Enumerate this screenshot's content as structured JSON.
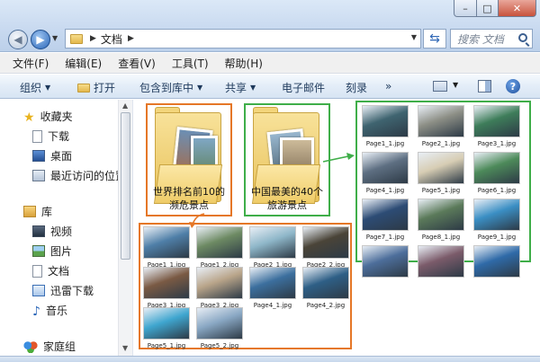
{
  "window": {
    "min_label": "–",
    "max_label": "□",
    "close_label": "✕"
  },
  "address": {
    "path": "文档",
    "search_placeholder": "搜索 文档"
  },
  "menu": [
    "文件(F)",
    "编辑(E)",
    "查看(V)",
    "工具(T)",
    "帮助(H)"
  ],
  "commands": {
    "organize": "组织",
    "open": "打开",
    "include": "包含到库中",
    "share": "共享",
    "email": "电子邮件",
    "burn": "刻录",
    "more": "»",
    "help": "?"
  },
  "nav": {
    "favorites": "收藏夹",
    "downloads": "下载",
    "desktop": "桌面",
    "recent": "最近访问的位置",
    "libraries": "库",
    "videos": "视频",
    "pictures": "图片",
    "documents": "文档",
    "xunlei": "迅雷下载",
    "music": "音乐",
    "homegroup": "家庭组"
  },
  "folders": {
    "left_label_line1": "世界排名前10的",
    "left_label_line2": "濒危景点",
    "right_label_line1": "中国最美的40个",
    "right_label_line2": "旅游景点"
  },
  "left_files": [
    {
      "name": "Page1_1.jpg",
      "color": "#4f7fa8"
    },
    {
      "name": "Page1_2.jpg",
      "color": "#6d8a63"
    },
    {
      "name": "Page2_1.jpg",
      "color": "#8fb7c9"
    },
    {
      "name": "Page2_2.jpg",
      "color": "#4a4438"
    },
    {
      "name": "Page3_1.jpg",
      "color": "#7a5a44"
    },
    {
      "name": "Page3_2.jpg",
      "color": "#b9a58a"
    },
    {
      "name": "Page4_1.jpg",
      "color": "#3c6f9e"
    },
    {
      "name": "Page4_2.jpg",
      "color": "#2e5f86"
    },
    {
      "name": "Page5_1.jpg",
      "color": "#3fa6cf"
    },
    {
      "name": "Page5_2.jpg",
      "color": "#8aa8c4"
    }
  ],
  "right_files": [
    {
      "name": "Page1_1.jpg",
      "color": "#3f6470"
    },
    {
      "name": "Page2_1.jpg",
      "color": "#8d8f86"
    },
    {
      "name": "Page3_1.jpg",
      "color": "#3e7d5a"
    },
    {
      "name": "Page4_1.jpg",
      "color": "#5e6f82"
    },
    {
      "name": "Page5_1.jpg",
      "color": "#d7cdb4"
    },
    {
      "name": "Page6_1.jpg",
      "color": "#4d8a5a"
    },
    {
      "name": "Page7_1.jpg",
      "color": "#2d4c75"
    },
    {
      "name": "Page8_1.jpg",
      "color": "#5b7a5a"
    },
    {
      "name": "Page9_1.jpg",
      "color": "#3b8fc4"
    },
    {
      "name": "",
      "color": "#4d6e9b"
    },
    {
      "name": "",
      "color": "#7b5b6a"
    },
    {
      "name": "",
      "color": "#2f6aa8"
    }
  ],
  "colors": {
    "highlight_orange": "#e57727",
    "highlight_green": "#3fae49"
  }
}
